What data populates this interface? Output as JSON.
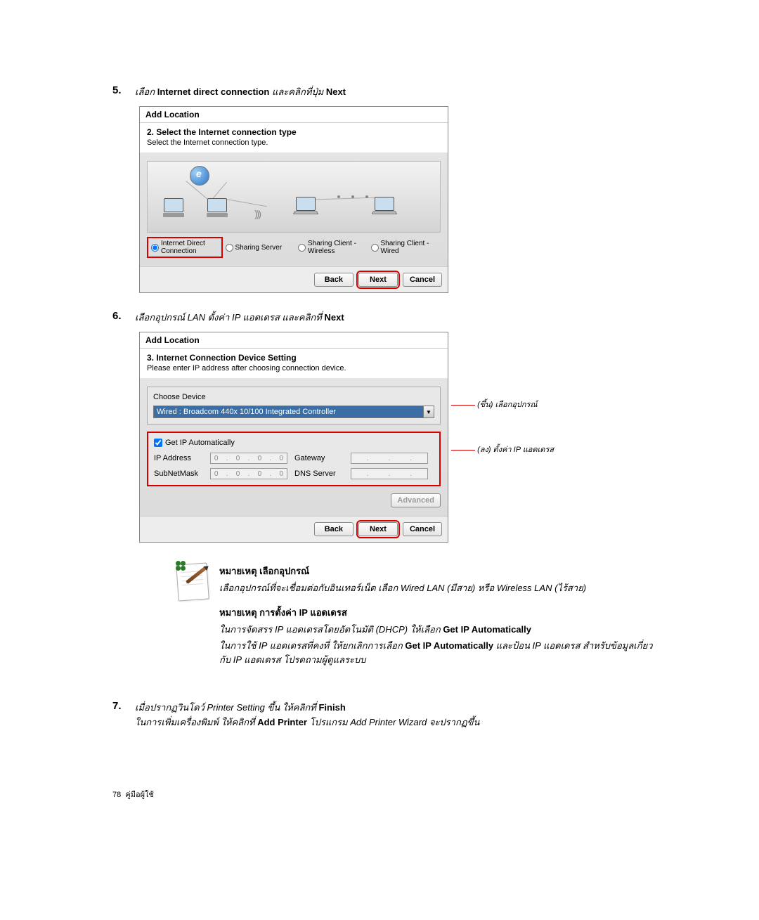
{
  "steps": {
    "s5": {
      "num": "5.",
      "pre": "เลือก ",
      "bold": "Internet direct connection",
      "mid": " และคลิกที่ปุ่ม  ",
      "bold2": "Next"
    },
    "s6": {
      "num": "6.",
      "text": "เลือกอุปกรณ์ LAN ตั้งค่า IP แอดเดรส และคลิกที่  ",
      "bold": "Next"
    },
    "s7": {
      "num": "7.",
      "pre": "เมื่อปรากฏวินโดว์ Printer Setting ขึ้น ให้คลิกที่ ",
      "bold": "Finish",
      "line2_pre": "ในการเพิ่มเครื่องพิมพ์ ให้คลิกที่ ",
      "line2_bold": "Add Printer",
      "line2_post": "  โปรแกรม Add Printer Wizard จะปรากฏขึ้น"
    }
  },
  "dialog1": {
    "title": "Add Location",
    "h_title": "2. Select the Internet connection type",
    "h_sub": "Select the Internet connection type.",
    "opts": {
      "direct": "Internet Direct Connection",
      "server": "Sharing Server",
      "wireless": "Sharing Client - Wireless",
      "wired": "Sharing Client - Wired"
    },
    "buttons": {
      "back": "Back",
      "next": "Next",
      "cancel": "Cancel"
    }
  },
  "dialog2": {
    "title": "Add Location",
    "h_title": "3. Internet Connection Device Setting",
    "h_sub": "Please enter IP address after choosing connection device.",
    "choose_label": "Choose Device",
    "device_value": "Wired : Broadcom 440x 10/100 Integrated Controller",
    "auto_label": "Get IP Automatically",
    "fields": {
      "ip": "IP Address",
      "mask": "SubNetMask",
      "gw": "Gateway",
      "dns": "DNS Server"
    },
    "ip_placeholder": {
      "a": "0",
      "b": "0",
      "c": "0",
      "d": "0"
    },
    "advanced": "Advanced",
    "buttons": {
      "back": "Back",
      "next": "Next",
      "cancel": "Cancel"
    },
    "annot_top": "(ขึ้น) เลือกอุปกรณ์",
    "annot_bottom": "(ลง) ตั้งค่า IP แอดเดรส"
  },
  "note": {
    "h1": "หมายเหตุ เลือกอุปกรณ์",
    "p1": "เลือกอุปกรณ์ที่จะเชื่อมต่อกับอินเทอร์เน็ต   เลือก Wired LAN (มีสาย) หรือ Wireless LAN (ไร้สาย)",
    "h2": "หมายเหตุ การตั้งค่า IP แอดเดรส",
    "p2_pre": "ในการจัดสรร IP แอดเดรสโดยอัตโนมัติ (DHCP) ให้เลือก ",
    "p2_bold": "Get IP Automatically",
    "p3_pre": "ในการใช้ IP แอดเดรสที่คงที่ ให้ยกเลิกการเลือก ",
    "p3_bold": "Get IP Automatically",
    "p3_post": " และป้อน IP แอดเดรส สำหรับข้อมูลเกี่ยวกับ IP แอดเดรส โปรดถามผู้ดูแลระบบ"
  },
  "footer": {
    "page": "78",
    "label": "คู่มือผู้ใช้"
  }
}
